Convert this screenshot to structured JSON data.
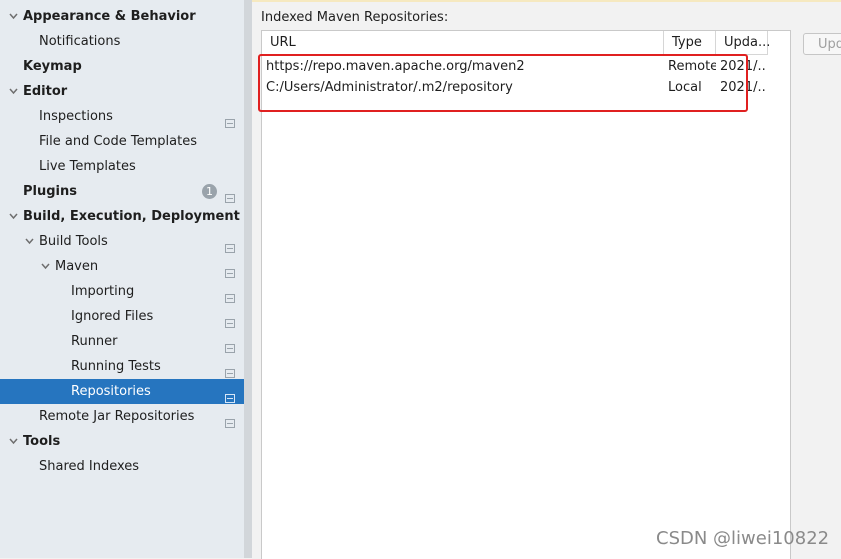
{
  "sidebar": {
    "items": [
      {
        "label": "Appearance & Behavior",
        "bold": true,
        "expanded": true
      },
      {
        "label": "Notifications"
      },
      {
        "label": "Keymap",
        "bold": true
      },
      {
        "label": "Editor",
        "bold": true,
        "expanded": true
      },
      {
        "label": "Inspections"
      },
      {
        "label": "File and Code Templates"
      },
      {
        "label": "Live Templates"
      },
      {
        "label": "Plugins",
        "bold": true,
        "badge": "1"
      },
      {
        "label": "Build, Execution, Deployment",
        "bold": true,
        "expanded": true
      },
      {
        "label": "Build Tools",
        "expanded": true
      },
      {
        "label": "Maven",
        "expanded": true
      },
      {
        "label": "Importing"
      },
      {
        "label": "Ignored Files"
      },
      {
        "label": "Runner"
      },
      {
        "label": "Running Tests"
      },
      {
        "label": "Repositories",
        "selected": true
      },
      {
        "label": "Remote Jar Repositories"
      },
      {
        "label": "Tools",
        "bold": true,
        "expanded": true
      },
      {
        "label": "Shared Indexes"
      }
    ]
  },
  "main": {
    "section_title": "Indexed Maven Repositories:",
    "table": {
      "columns": [
        "URL",
        "Type",
        "Upda..."
      ],
      "rows": [
        {
          "url": "https://repo.maven.apache.org/maven2",
          "type": "Remote",
          "updated": "2021/..."
        },
        {
          "url": "C:/Users/Administrator/.m2/repository",
          "type": "Local",
          "updated": "2021/..."
        }
      ]
    },
    "update_button": "Upd"
  },
  "watermark": "CSDN @liwei10822",
  "colors": {
    "selection": "#2675bf",
    "highlight_box": "#e02020",
    "sidebar_bg": "#e6ebf0"
  }
}
